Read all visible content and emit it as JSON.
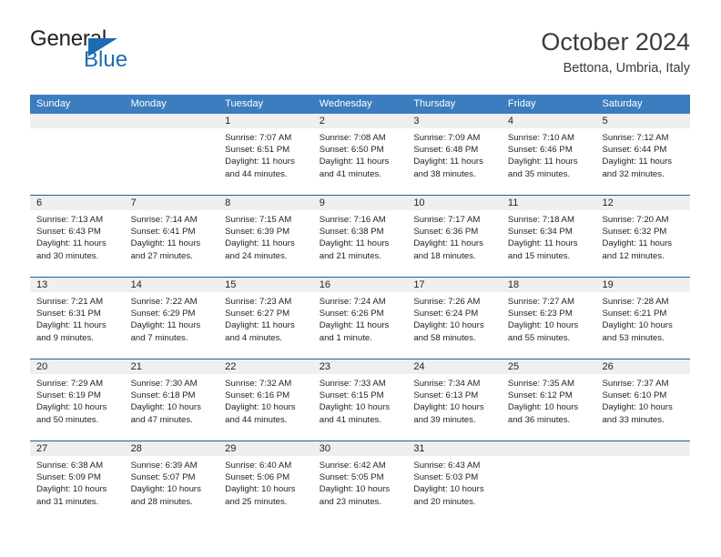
{
  "brand": {
    "name_top": "General",
    "name_bottom": "Blue",
    "accent_color": "#1b6cb0"
  },
  "header": {
    "title": "October 2024",
    "subtitle": "Bettona, Umbria, Italy"
  },
  "theme": {
    "header_row_bg": "#3b7dbf",
    "daynum_band_bg": "#efefef",
    "week_divider": "#1b5fa3",
    "text": "#231f20"
  },
  "weekday_headers": [
    "Sunday",
    "Monday",
    "Tuesday",
    "Wednesday",
    "Thursday",
    "Friday",
    "Saturday"
  ],
  "weeks": [
    {
      "days": [
        {
          "num": "",
          "lines": [
            "",
            "",
            "",
            ""
          ]
        },
        {
          "num": "",
          "lines": [
            "",
            "",
            "",
            ""
          ]
        },
        {
          "num": "1",
          "lines": [
            "Sunrise: 7:07 AM",
            "Sunset: 6:51 PM",
            "Daylight: 11 hours",
            "and 44 minutes."
          ]
        },
        {
          "num": "2",
          "lines": [
            "Sunrise: 7:08 AM",
            "Sunset: 6:50 PM",
            "Daylight: 11 hours",
            "and 41 minutes."
          ]
        },
        {
          "num": "3",
          "lines": [
            "Sunrise: 7:09 AM",
            "Sunset: 6:48 PM",
            "Daylight: 11 hours",
            "and 38 minutes."
          ]
        },
        {
          "num": "4",
          "lines": [
            "Sunrise: 7:10 AM",
            "Sunset: 6:46 PM",
            "Daylight: 11 hours",
            "and 35 minutes."
          ]
        },
        {
          "num": "5",
          "lines": [
            "Sunrise: 7:12 AM",
            "Sunset: 6:44 PM",
            "Daylight: 11 hours",
            "and 32 minutes."
          ]
        }
      ]
    },
    {
      "days": [
        {
          "num": "6",
          "lines": [
            "Sunrise: 7:13 AM",
            "Sunset: 6:43 PM",
            "Daylight: 11 hours",
            "and 30 minutes."
          ]
        },
        {
          "num": "7",
          "lines": [
            "Sunrise: 7:14 AM",
            "Sunset: 6:41 PM",
            "Daylight: 11 hours",
            "and 27 minutes."
          ]
        },
        {
          "num": "8",
          "lines": [
            "Sunrise: 7:15 AM",
            "Sunset: 6:39 PM",
            "Daylight: 11 hours",
            "and 24 minutes."
          ]
        },
        {
          "num": "9",
          "lines": [
            "Sunrise: 7:16 AM",
            "Sunset: 6:38 PM",
            "Daylight: 11 hours",
            "and 21 minutes."
          ]
        },
        {
          "num": "10",
          "lines": [
            "Sunrise: 7:17 AM",
            "Sunset: 6:36 PM",
            "Daylight: 11 hours",
            "and 18 minutes."
          ]
        },
        {
          "num": "11",
          "lines": [
            "Sunrise: 7:18 AM",
            "Sunset: 6:34 PM",
            "Daylight: 11 hours",
            "and 15 minutes."
          ]
        },
        {
          "num": "12",
          "lines": [
            "Sunrise: 7:20 AM",
            "Sunset: 6:32 PM",
            "Daylight: 11 hours",
            "and 12 minutes."
          ]
        }
      ]
    },
    {
      "days": [
        {
          "num": "13",
          "lines": [
            "Sunrise: 7:21 AM",
            "Sunset: 6:31 PM",
            "Daylight: 11 hours",
            "and 9 minutes."
          ]
        },
        {
          "num": "14",
          "lines": [
            "Sunrise: 7:22 AM",
            "Sunset: 6:29 PM",
            "Daylight: 11 hours",
            "and 7 minutes."
          ]
        },
        {
          "num": "15",
          "lines": [
            "Sunrise: 7:23 AM",
            "Sunset: 6:27 PM",
            "Daylight: 11 hours",
            "and 4 minutes."
          ]
        },
        {
          "num": "16",
          "lines": [
            "Sunrise: 7:24 AM",
            "Sunset: 6:26 PM",
            "Daylight: 11 hours",
            "and 1 minute."
          ]
        },
        {
          "num": "17",
          "lines": [
            "Sunrise: 7:26 AM",
            "Sunset: 6:24 PM",
            "Daylight: 10 hours",
            "and 58 minutes."
          ]
        },
        {
          "num": "18",
          "lines": [
            "Sunrise: 7:27 AM",
            "Sunset: 6:23 PM",
            "Daylight: 10 hours",
            "and 55 minutes."
          ]
        },
        {
          "num": "19",
          "lines": [
            "Sunrise: 7:28 AM",
            "Sunset: 6:21 PM",
            "Daylight: 10 hours",
            "and 53 minutes."
          ]
        }
      ]
    },
    {
      "days": [
        {
          "num": "20",
          "lines": [
            "Sunrise: 7:29 AM",
            "Sunset: 6:19 PM",
            "Daylight: 10 hours",
            "and 50 minutes."
          ]
        },
        {
          "num": "21",
          "lines": [
            "Sunrise: 7:30 AM",
            "Sunset: 6:18 PM",
            "Daylight: 10 hours",
            "and 47 minutes."
          ]
        },
        {
          "num": "22",
          "lines": [
            "Sunrise: 7:32 AM",
            "Sunset: 6:16 PM",
            "Daylight: 10 hours",
            "and 44 minutes."
          ]
        },
        {
          "num": "23",
          "lines": [
            "Sunrise: 7:33 AM",
            "Sunset: 6:15 PM",
            "Daylight: 10 hours",
            "and 41 minutes."
          ]
        },
        {
          "num": "24",
          "lines": [
            "Sunrise: 7:34 AM",
            "Sunset: 6:13 PM",
            "Daylight: 10 hours",
            "and 39 minutes."
          ]
        },
        {
          "num": "25",
          "lines": [
            "Sunrise: 7:35 AM",
            "Sunset: 6:12 PM",
            "Daylight: 10 hours",
            "and 36 minutes."
          ]
        },
        {
          "num": "26",
          "lines": [
            "Sunrise: 7:37 AM",
            "Sunset: 6:10 PM",
            "Daylight: 10 hours",
            "and 33 minutes."
          ]
        }
      ]
    },
    {
      "days": [
        {
          "num": "27",
          "lines": [
            "Sunrise: 6:38 AM",
            "Sunset: 5:09 PM",
            "Daylight: 10 hours",
            "and 31 minutes."
          ]
        },
        {
          "num": "28",
          "lines": [
            "Sunrise: 6:39 AM",
            "Sunset: 5:07 PM",
            "Daylight: 10 hours",
            "and 28 minutes."
          ]
        },
        {
          "num": "29",
          "lines": [
            "Sunrise: 6:40 AM",
            "Sunset: 5:06 PM",
            "Daylight: 10 hours",
            "and 25 minutes."
          ]
        },
        {
          "num": "30",
          "lines": [
            "Sunrise: 6:42 AM",
            "Sunset: 5:05 PM",
            "Daylight: 10 hours",
            "and 23 minutes."
          ]
        },
        {
          "num": "31",
          "lines": [
            "Sunrise: 6:43 AM",
            "Sunset: 5:03 PM",
            "Daylight: 10 hours",
            "and 20 minutes."
          ]
        },
        {
          "num": "",
          "lines": [
            "",
            "",
            "",
            ""
          ]
        },
        {
          "num": "",
          "lines": [
            "",
            "",
            "",
            ""
          ]
        }
      ]
    }
  ]
}
